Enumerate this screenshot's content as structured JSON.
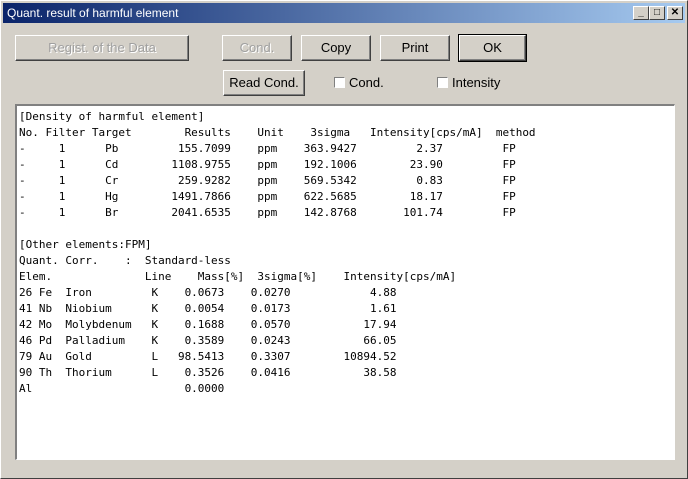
{
  "window": {
    "title": "Quant. result of harmful element"
  },
  "buttons": {
    "regist": "Regist. of the Data",
    "cond": "Cond.",
    "copy": "Copy",
    "print": "Print",
    "ok": "OK",
    "read_cond": "Read Cond."
  },
  "checkboxes": {
    "cond": "Cond.",
    "intensity": "Intensity"
  },
  "report": {
    "lines": [
      "[Density of harmful element]",
      "No. Filter Target        Results    Unit    3sigma   Intensity[cps/mA]  method",
      "-     1      Pb         155.7099    ppm    363.9427         2.37         FP",
      "-     1      Cd        1108.9755    ppm    192.1006        23.90         FP",
      "-     1      Cr         259.9282    ppm    569.5342         0.83         FP",
      "-     1      Hg        1491.7866    ppm    622.5685        18.17         FP",
      "-     1      Br        2041.6535    ppm    142.8768       101.74         FP",
      "",
      "[Other elements:FPM]",
      "Quant. Corr.    :  Standard-less",
      "Elem.              Line    Mass[%]  3sigma[%]    Intensity[cps/mA]",
      "26 Fe  Iron         K    0.0673    0.0270            4.88",
      "41 Nb  Niobium      K    0.0054    0.0173            1.61",
      "42 Mo  Molybdenum   K    0.1688    0.0570           17.94",
      "46 Pd  Palladium    K    0.3589    0.0243           66.05",
      "79 Au  Gold         L   98.5413    0.3307        10894.52",
      "90 Th  Thorium      L    0.3526    0.0416           38.58",
      "Al                       0.0000"
    ]
  }
}
